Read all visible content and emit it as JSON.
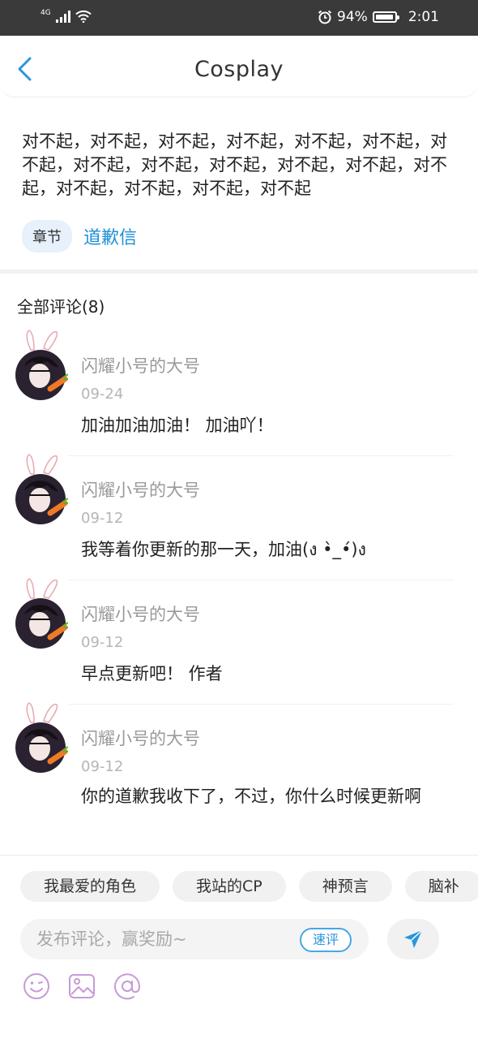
{
  "status_bar": {
    "network": "4G",
    "battery": "94%",
    "battery_level": 0.94,
    "time": "2:01"
  },
  "header": {
    "title": "Cosplay",
    "back_icon": "chevron-left-icon"
  },
  "post": {
    "content": "对不起，对不起，对不起，对不起，对不起，对不起，对不起，对不起，对不起，对不起，对不起，对不起，对不起，对不起，对不起，对不起，对不起",
    "tag_chip": "章节",
    "tag_link": "道歉信"
  },
  "comments": {
    "title": "全部评论(8)",
    "items": [
      {
        "user": "闪耀小号的大号",
        "date": "09-24",
        "text": "加油加油加油！ 加油吖！"
      },
      {
        "user": "闪耀小号的大号",
        "date": "09-12",
        "text": "我等着你更新的那一天，加油(ง •̀_•́)ง"
      },
      {
        "user": "闪耀小号的大号",
        "date": "09-12",
        "text": "早点更新吧！ 作者"
      },
      {
        "user": "闪耀小号的大号",
        "date": "09-12",
        "text": "你的道歉我收下了，不过，你什么时候更新啊"
      }
    ]
  },
  "bottom_bar": {
    "topic_chips": [
      "我最爱的角色",
      "我站的CP",
      "神预言",
      "脑补"
    ],
    "input_placeholder": "发布评论，赢奖励~",
    "quick_button": "速评",
    "send_icon": "send-icon",
    "tool_icons": [
      "emoji-icon",
      "image-icon",
      "at-icon"
    ]
  },
  "colors": {
    "accent": "#1e8fd6",
    "status_bar_bg": "#3a3a3a",
    "tool_icon": "#c59bd8"
  }
}
